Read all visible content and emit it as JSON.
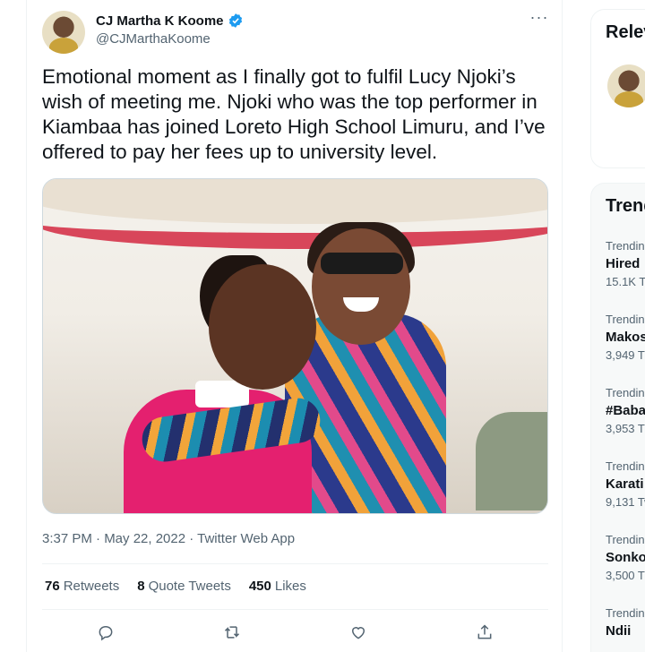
{
  "tweet": {
    "display_name": "CJ Martha K Koome",
    "handle": "@CJMarthaKoome",
    "more_label": "···",
    "text": "Emotional moment as I finally got to fulfil Lucy Njoki’s wish of meeting me. Njoki who was the top performer in Kiambaa has joined Loreto High School Limuru, and I’ve offered to pay her fees up to university level.",
    "timestamp": "3:37 PM · May 22, 2022 · Twitter Web App",
    "stats": {
      "retweets_count": "76",
      "retweets_label": "Retweets",
      "quotes_count": "8",
      "quotes_label": "Quote Tweets",
      "likes_count": "450",
      "likes_label": "Likes"
    },
    "icons": [
      "reply-icon",
      "retweet-icon",
      "like-icon",
      "share-icon"
    ],
    "accent_color": "#1d9bf0"
  },
  "sidebar": {
    "relevant_title": "Relev",
    "trends_title": "Trend",
    "trends": [
      {
        "meta": "Trendin",
        "name": "Hired",
        "count": "15.1K Tw"
      },
      {
        "meta": "Trendin",
        "name": "Makos",
        "count": "3,949 T"
      },
      {
        "meta": "Trendin",
        "name": "#Baba",
        "count": "3,953 T"
      },
      {
        "meta": "Trendin",
        "name": "Karati",
        "count": "9,131 Tw"
      },
      {
        "meta": "Trendin",
        "name": "Sonko",
        "count": "3,500 T"
      },
      {
        "meta": "Trendin",
        "name": "Ndii",
        "count": ""
      }
    ]
  }
}
